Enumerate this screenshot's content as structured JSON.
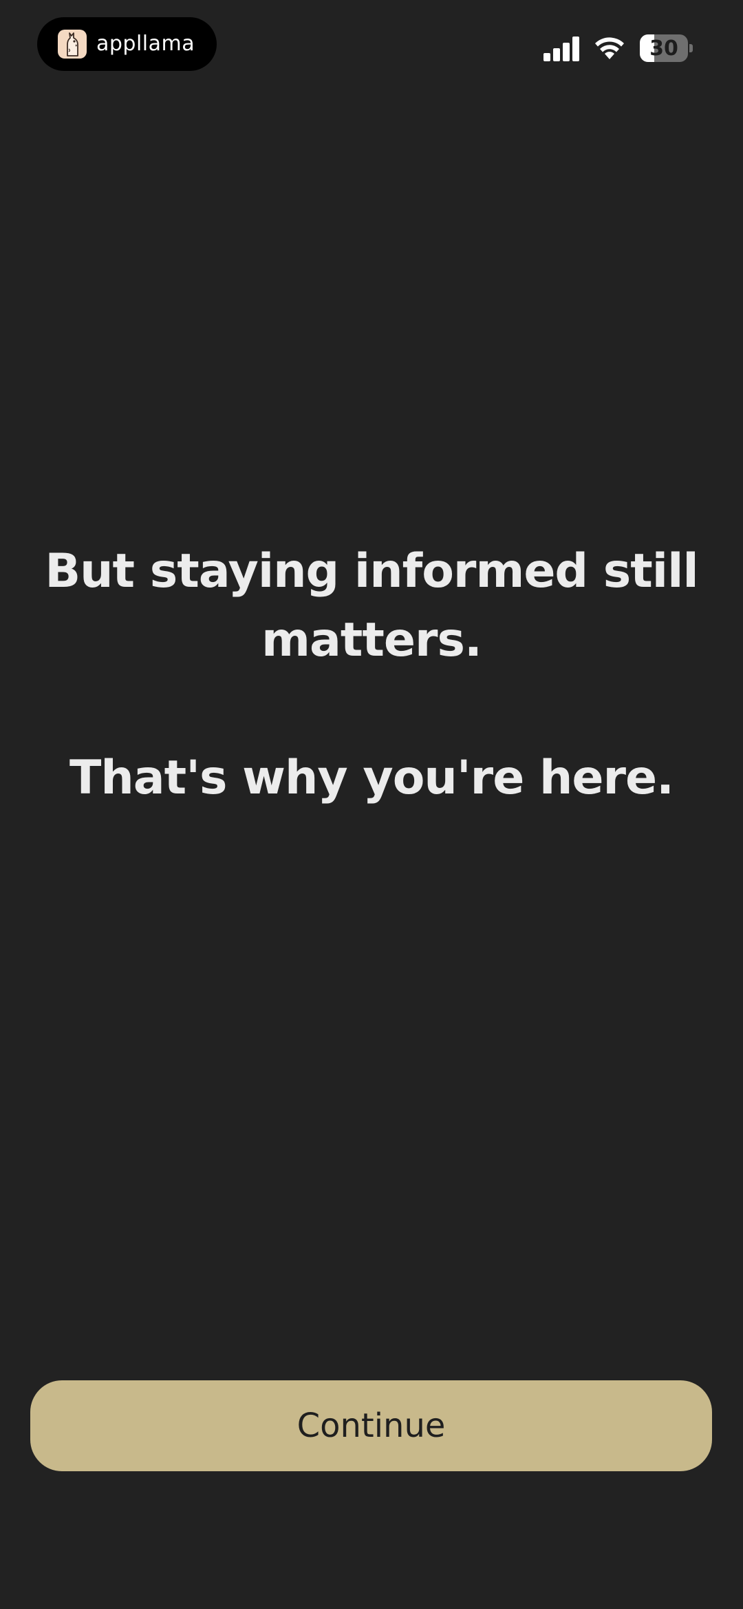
{
  "status_bar": {
    "app_name": "appllama",
    "battery_level": "30",
    "battery_percent": 30,
    "icons": [
      "llama-logo-icon",
      "cellular-signal-icon",
      "wifi-icon",
      "battery-icon"
    ]
  },
  "content": {
    "line_1": "But staying informed still matters.",
    "line_2": "That's why you're here."
  },
  "actions": {
    "continue_label": "Continue"
  },
  "colors": {
    "background": "#222222",
    "text": "#ececec",
    "button": "#c8b98b",
    "button_text": "#1f1f1f"
  }
}
